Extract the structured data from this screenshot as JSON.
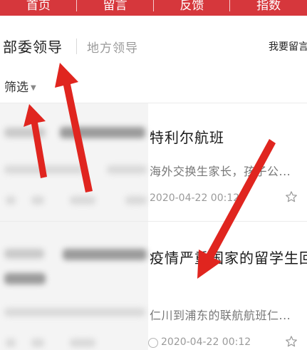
{
  "nav": {
    "items": [
      {
        "label": "首页"
      },
      {
        "label": "留言"
      },
      {
        "label": "反馈"
      },
      {
        "label": "指数"
      }
    ],
    "bg_color": "#d6373c"
  },
  "tabs": {
    "active": "部委领导",
    "inactive": "地方领导",
    "right_link": "我要留言"
  },
  "filter": {
    "label": "筛选",
    "caret_icon": "caret-down-icon"
  },
  "articles": [
    {
      "title": "特利尔航班",
      "summary": "海外交换生家长，孩子公...",
      "date": "2020-04-22 00:12",
      "star_icon": "star-outline-icon"
    },
    {
      "title": "疫情严重国家的留学生回",
      "summary": "仁川到浦东的联航航班仁...",
      "date": "2020-04-22 00:12",
      "star_icon": "star-outline-icon"
    }
  ],
  "annotation": {
    "arrow_color": "#e0251f"
  }
}
